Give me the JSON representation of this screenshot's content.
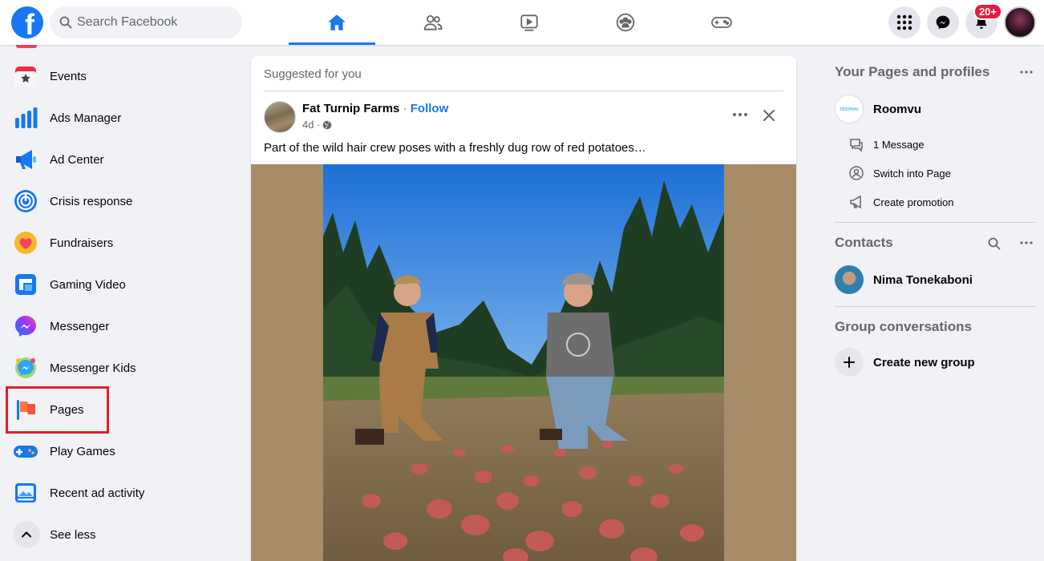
{
  "search": {
    "placeholder": "Search Facebook"
  },
  "nav": {
    "tabs": [
      {
        "name": "home-icon",
        "active": true
      },
      {
        "name": "friends-icon",
        "active": false
      },
      {
        "name": "watch-icon",
        "active": false
      },
      {
        "name": "groups-icon",
        "active": false
      },
      {
        "name": "gaming-icon",
        "active": false
      }
    ],
    "right": {
      "menu_icon": "grid-icon",
      "messenger_icon": "messenger-icon",
      "notifications_icon": "bell-icon",
      "notifications_badge": "20+"
    }
  },
  "sidebar": {
    "items": [
      {
        "label": "Events",
        "icon": "events-icon"
      },
      {
        "label": "Ads Manager",
        "icon": "ads-manager-icon"
      },
      {
        "label": "Ad Center",
        "icon": "megaphone-icon"
      },
      {
        "label": "Crisis response",
        "icon": "crisis-response-icon"
      },
      {
        "label": "Fundraisers",
        "icon": "fundraiser-heart-icon"
      },
      {
        "label": "Gaming Video",
        "icon": "gaming-video-icon"
      },
      {
        "label": "Messenger",
        "icon": "messenger-icon"
      },
      {
        "label": "Messenger Kids",
        "icon": "messenger-kids-icon"
      },
      {
        "label": "Pages",
        "icon": "flag-icon"
      },
      {
        "label": "Play Games",
        "icon": "gamepad-icon"
      },
      {
        "label": "Recent ad activity",
        "icon": "ad-activity-icon"
      },
      {
        "label": "See less",
        "icon": "chevron-up-icon"
      }
    ],
    "highlight_color": "#e0202a"
  },
  "post": {
    "section_label": "Suggested for you",
    "page_name": "Fat Turnip Farms",
    "separator": " · ",
    "follow_label": "Follow",
    "time": "4d ·",
    "text": "Part of the wild hair crew poses with a freshly dug row of red potatoes…"
  },
  "right": {
    "pages_heading": "Your Pages and profiles",
    "page": {
      "name": "Roomvu",
      "logo_text": "roomvu",
      "actions": [
        {
          "label": "1 Message",
          "icon": "message-icon"
        },
        {
          "label": "Switch into Page",
          "icon": "switch-profile-icon"
        },
        {
          "label": "Create promotion",
          "icon": "megaphone-icon"
        }
      ]
    },
    "contacts_heading": "Contacts",
    "contacts": [
      {
        "name": "Nima Tonekaboni"
      }
    ],
    "groups_heading": "Group conversations",
    "new_group_label": "Create new group"
  },
  "colors": {
    "brand": "#1877f2",
    "background": "#f0f2f5",
    "badge": "#e41e3f"
  }
}
